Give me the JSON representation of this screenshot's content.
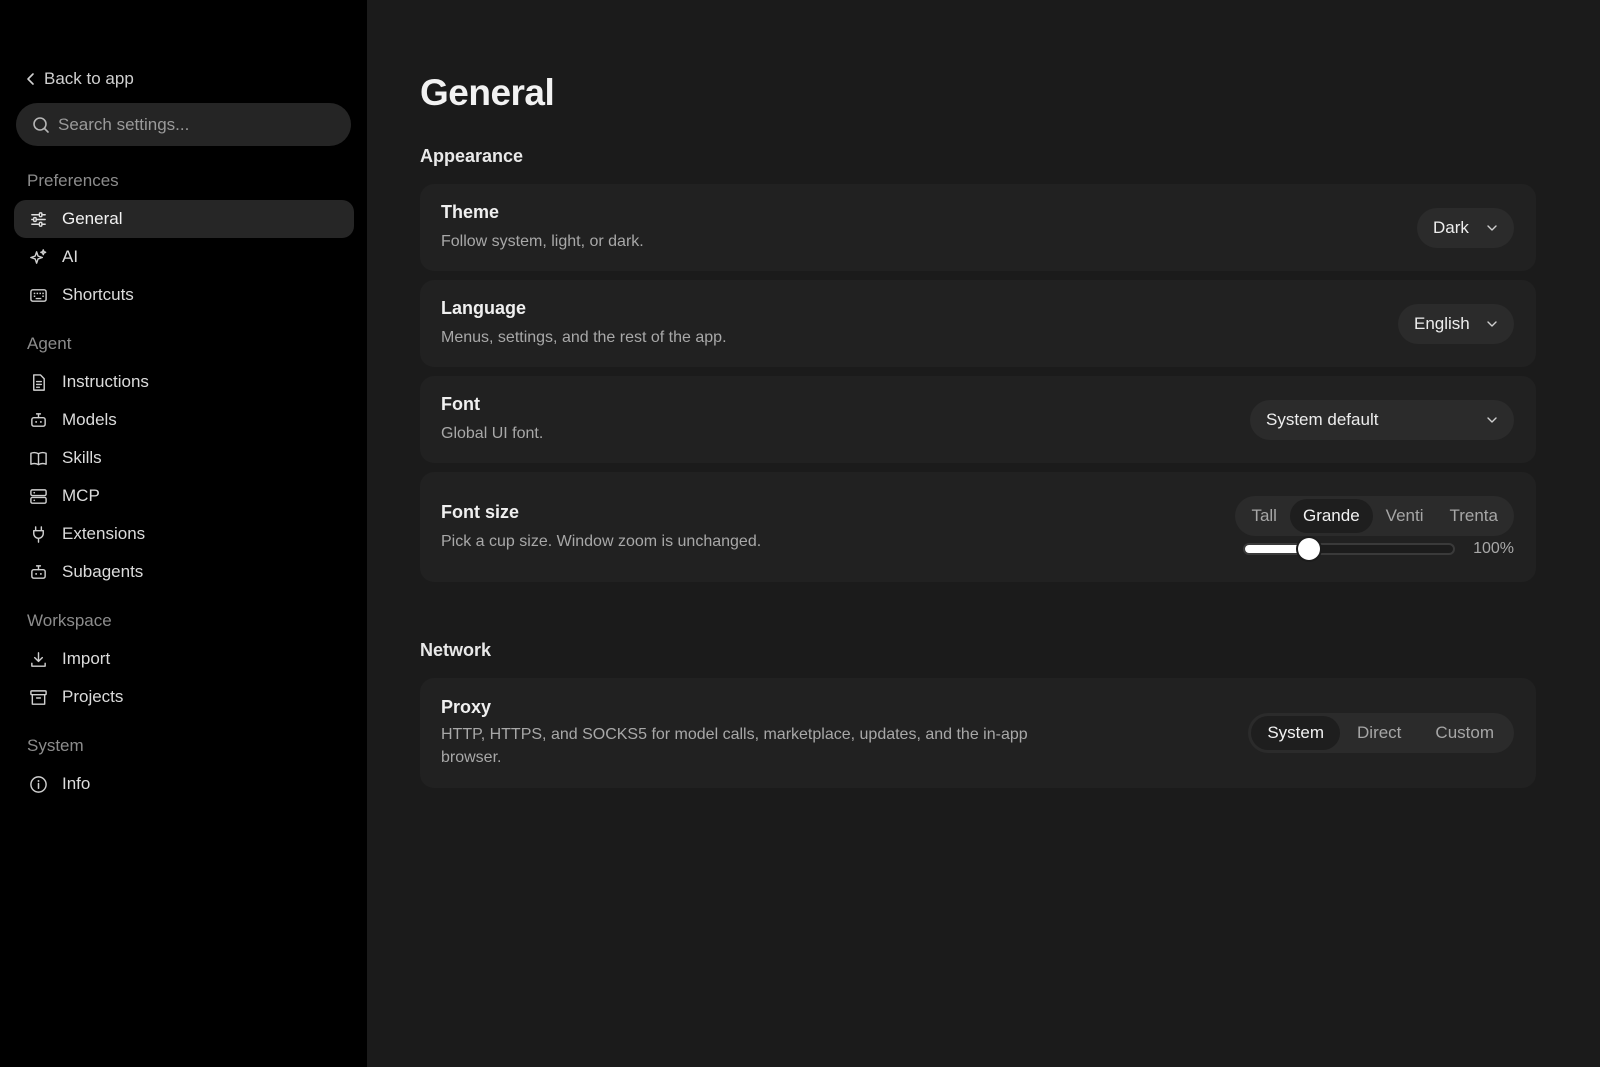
{
  "sidebar": {
    "back_label": "Back to app",
    "search_placeholder": "Search settings...",
    "groups": [
      {
        "title": "Preferences",
        "items": [
          {
            "label": "General",
            "icon": "sliders-icon",
            "active": true
          },
          {
            "label": "AI",
            "icon": "sparkles-icon"
          },
          {
            "label": "Shortcuts",
            "icon": "keyboard-icon"
          }
        ]
      },
      {
        "title": "Agent",
        "items": [
          {
            "label": "Instructions",
            "icon": "document-icon"
          },
          {
            "label": "Models",
            "icon": "robot-icon"
          },
          {
            "label": "Skills",
            "icon": "book-icon"
          },
          {
            "label": "MCP",
            "icon": "server-icon"
          },
          {
            "label": "Extensions",
            "icon": "plug-icon"
          },
          {
            "label": "Subagents",
            "icon": "robot-icon"
          }
        ]
      },
      {
        "title": "Workspace",
        "items": [
          {
            "label": "Import",
            "icon": "download-icon"
          },
          {
            "label": "Projects",
            "icon": "archive-icon"
          }
        ]
      },
      {
        "title": "System",
        "items": [
          {
            "label": "Info",
            "icon": "info-icon"
          }
        ]
      }
    ]
  },
  "main": {
    "title": "General",
    "appearance": {
      "section_title": "Appearance",
      "theme": {
        "label": "Theme",
        "desc": "Follow system, light, or dark.",
        "value": "Dark"
      },
      "language": {
        "label": "Language",
        "desc": "Menus, settings, and the rest of the app.",
        "value": "English"
      },
      "font": {
        "label": "Font",
        "desc": "Global UI font.",
        "value": "System default"
      },
      "font_size": {
        "label": "Font size",
        "desc": "Pick a cup size. Window zoom is unchanged.",
        "options": [
          "Tall",
          "Grande",
          "Venti",
          "Trenta"
        ],
        "selected": "Grande",
        "slider_fraction": 0.31,
        "slider_value": "100%"
      }
    },
    "network": {
      "section_title": "Network",
      "proxy": {
        "label": "Proxy",
        "desc_line1": "HTTP, HTTPS, and SOCKS5 for model calls, marketplace, updates, and the in-app",
        "desc_line2": "browser.",
        "options": [
          "System",
          "Direct",
          "Custom"
        ],
        "selected": "System"
      }
    }
  },
  "colors": {
    "sidebar_bg": "#000000",
    "main_bg": "#1b1b1b",
    "card_bg": "#212121",
    "active_nav_bg": "#262626"
  }
}
